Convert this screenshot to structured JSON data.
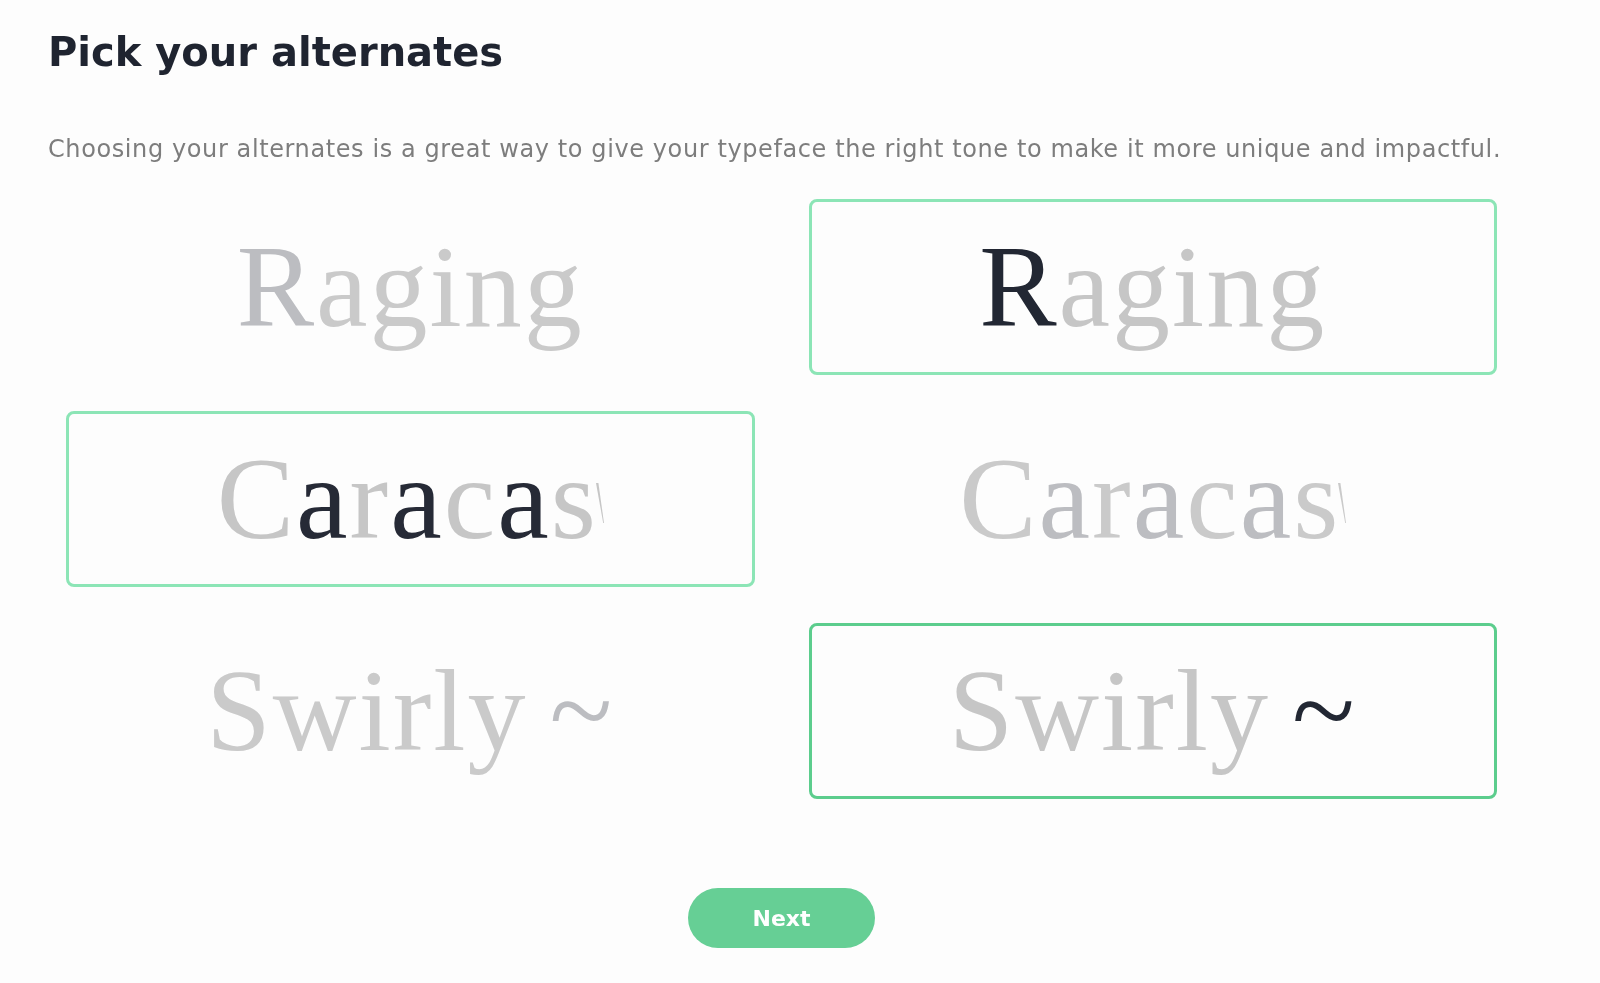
{
  "title": "Pick your alternates",
  "description": "Choosing your alternates is a great way to give your typeface the right tone to make it more unique and impactful.",
  "rows": [
    {
      "options": [
        {
          "selected": false,
          "focused": false,
          "words": [
            {
              "glyphs": [
                {
                  "text": "R",
                  "color": "#bcbdc1"
                },
                {
                  "text": "aging",
                  "color": "#cacaca"
                }
              ]
            }
          ]
        },
        {
          "selected": true,
          "focused": false,
          "words": [
            {
              "glyphs": [
                {
                  "text": "R",
                  "color": "#222733"
                },
                {
                  "text": "aging",
                  "color": "#c6c6c6"
                }
              ]
            }
          ]
        }
      ]
    },
    {
      "options": [
        {
          "selected": true,
          "focused": false,
          "words": [
            {
              "glyphs": [
                {
                  "text": "C",
                  "color": "#c6c6c6"
                },
                {
                  "text": "a",
                  "color": "#262a36"
                },
                {
                  "text": "r",
                  "color": "#c6c6c6"
                },
                {
                  "text": "a",
                  "color": "#262a36"
                },
                {
                  "text": "c",
                  "color": "#c6c6c6"
                },
                {
                  "text": "a",
                  "color": "#262a36"
                },
                {
                  "text": "s",
                  "color": "#c6c6c6",
                  "swash": true
                }
              ]
            }
          ]
        },
        {
          "selected": false,
          "focused": false,
          "words": [
            {
              "glyphs": [
                {
                  "text": "C",
                  "color": "#cacaca"
                },
                {
                  "text": "a",
                  "color": "#bcbdc1"
                },
                {
                  "text": "r",
                  "color": "#cacaca"
                },
                {
                  "text": "a",
                  "color": "#bcbdc1"
                },
                {
                  "text": "c",
                  "color": "#cacaca"
                },
                {
                  "text": "a",
                  "color": "#bcbdc1"
                },
                {
                  "text": "s",
                  "color": "#cacaca",
                  "swash": true
                }
              ]
            }
          ]
        }
      ]
    },
    {
      "options": [
        {
          "selected": false,
          "focused": false,
          "words": [
            {
              "glyphs": [
                {
                  "text": "Swirly",
                  "color": "#cacaca"
                }
              ]
            },
            {
              "glyphs": [
                {
                  "text": "~",
                  "color": "#bcbdc1"
                }
              ]
            }
          ]
        },
        {
          "selected": true,
          "focused": true,
          "words": [
            {
              "glyphs": [
                {
                  "text": "Swirly",
                  "color": "#c6c6c6"
                }
              ]
            },
            {
              "glyphs": [
                {
                  "text": "~",
                  "color": "#222733"
                }
              ]
            }
          ]
        }
      ]
    }
  ],
  "next_button": "Next"
}
